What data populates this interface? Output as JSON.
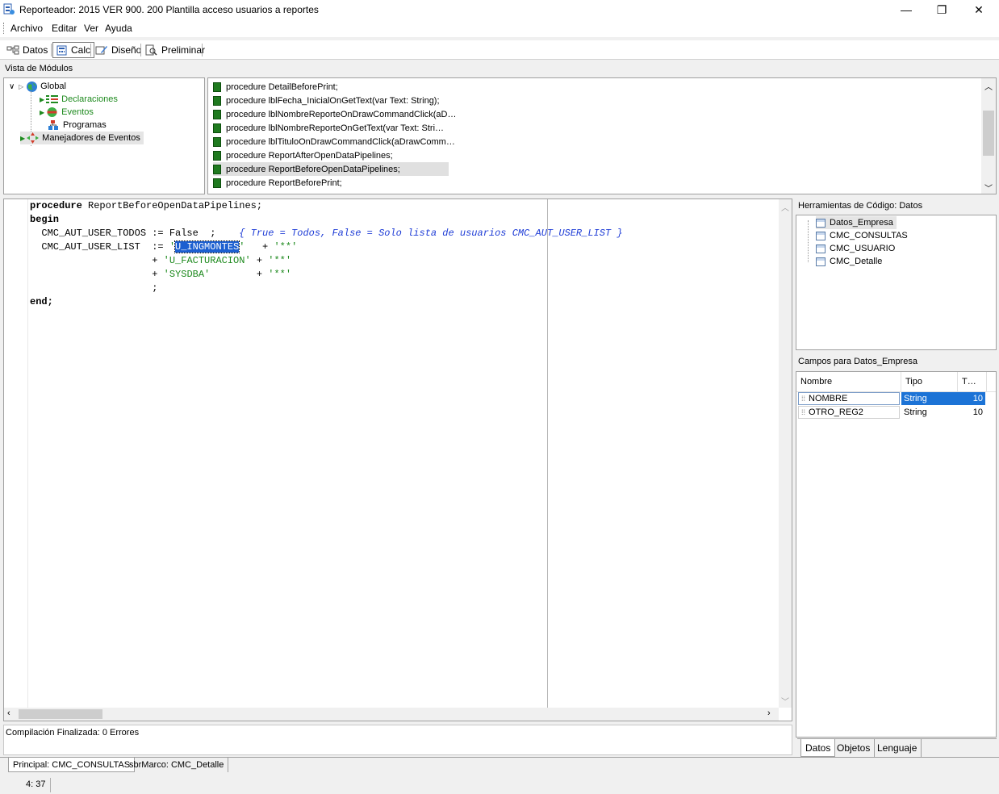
{
  "window": {
    "title": "Reporteador: 2015 VER 900. 200 Plantilla acceso usuarios a reportes",
    "minimize_glyph": "—",
    "restore_glyph": "❐",
    "close_glyph": "✕"
  },
  "menu": [
    "Archivo",
    "Editar",
    "Ver",
    "Ayuda"
  ],
  "tabs": [
    {
      "label": "Datos",
      "icon": "data-tree-icon"
    },
    {
      "label": "Calc",
      "icon": "calc-icon",
      "active": true
    },
    {
      "label": "Diseño",
      "icon": "design-icon"
    },
    {
      "label": "Preliminar",
      "icon": "preview-icon"
    }
  ],
  "module_view": {
    "label": "Vista de Módulos",
    "tree": [
      {
        "label": "Global",
        "icon": "globe-icon"
      },
      {
        "label": "Declaraciones",
        "icon": "declarations-icon"
      },
      {
        "label": "Eventos",
        "icon": "events-icon"
      },
      {
        "label": "Programas",
        "icon": "programs-icon"
      },
      {
        "label": "Manejadores de Eventos",
        "icon": "event-handlers-icon"
      }
    ]
  },
  "procedures": [
    "procedure DetailBeforePrint;",
    "procedure lblFecha_InicialOnGetText(var Text: String);",
    "procedure lblNombreReporteOnDrawCommandClick(aD…",
    "procedure lblNombreReporteOnGetText(var Text: Stri…",
    "procedure lblTituloOnDrawCommandClick(aDrawComm…",
    "procedure ReportAfterOpenDataPipelines;",
    "procedure ReportBeforeOpenDataPipelines;",
    "procedure ReportBeforePrint;"
  ],
  "code": {
    "l1_kw": "procedure",
    "l1_rest": " ReportBeforeOpenDataPipelines;",
    "l2": "begin",
    "l3_code": "  CMC_AUT_USER_TODOS := False  ;    ",
    "l3_comment": "{ True = Todos, False = Solo lista de usuarios CMC_AUT_USER_LIST }",
    "l4_code": "  CMC_AUT_USER_LIST  := ",
    "l4_q1": "'",
    "l4_sel": "U_INGMONTES",
    "l4_q2": "'",
    "l4_tail": "   + ",
    "l4_str2": "'**'",
    "l5_pre": "                     + ",
    "l5_str": "'U_FACTURACION'",
    "l5_mid": " + ",
    "l5_str2": "'**'",
    "l6_pre": "                     + ",
    "l6_str": "'SYSDBA'",
    "l6_mid": "        + ",
    "l6_str2": "'**'",
    "l7": "                     ;",
    "l9": "end;"
  },
  "code_tools": {
    "label": "Herramientas de Código: Datos",
    "items": [
      "Datos_Empresa",
      "CMC_CONSULTAS",
      "CMC_USUARIO",
      "CMC_Detalle"
    ]
  },
  "fields": {
    "label": "Campos para Datos_Empresa",
    "columns": [
      "Nombre",
      "Tipo",
      "T…"
    ],
    "rows": [
      {
        "name": "NOMBRE",
        "type": "String",
        "size": "10"
      },
      {
        "name": "OTRO_REG2",
        "type": "String",
        "size": "10"
      }
    ]
  },
  "right_tabs": [
    "Datos",
    "Objetos",
    "Lenguaje"
  ],
  "compile_message": "Compilación Finalizada: 0 Errores",
  "bottom_tabs": [
    "Principal: CMC_CONSULTAS",
    "sbrMarco: CMC_Detalle"
  ],
  "status": {
    "position": "4: 37"
  },
  "colors": {
    "selection": "#1c5fd0",
    "string": "#1e8a1e",
    "comment": "#1e3cd6"
  }
}
